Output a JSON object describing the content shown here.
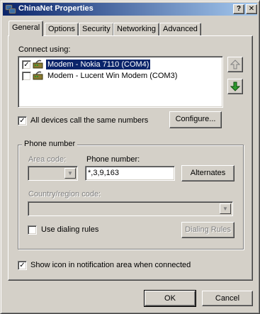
{
  "window": {
    "title": "ChinaNet Properties",
    "help_glyph": "?",
    "close_glyph": "✕"
  },
  "tabs": [
    {
      "label": "General"
    },
    {
      "label": "Options"
    },
    {
      "label": "Security"
    },
    {
      "label": "Networking"
    },
    {
      "label": "Advanced"
    }
  ],
  "general": {
    "connect_using_label": "Connect using:",
    "devices": [
      {
        "label": "Modem - Nokia 7110 (COM4)",
        "checked": true,
        "selected": true
      },
      {
        "label": "Modem - Lucent Win Modem (COM3)",
        "checked": false,
        "selected": false
      }
    ],
    "all_devices_label": "All devices call the same numbers",
    "all_devices_checked": true,
    "configure_label": "Configure...",
    "phone_group_title": "Phone number",
    "area_code_label": "Area code:",
    "phone_number_label": "Phone number:",
    "phone_number_value": "*,3,9,163",
    "alternates_label": "Alternates",
    "country_label": "Country/region code:",
    "use_dialing_rules_label": "Use dialing rules",
    "use_dialing_rules_checked": false,
    "dialing_rules_label": "Dialing Rules",
    "show_icon_label": "Show icon in notification area when connected",
    "show_icon_checked": true
  },
  "footer": {
    "ok_label": "OK",
    "cancel_label": "Cancel"
  },
  "colors": {
    "titlebar_start": "#0a246a",
    "titlebar_end": "#a6caf0",
    "face": "#d4d0c8",
    "selection": "#0a246a"
  },
  "icons": {
    "app": "network-connection-icon",
    "device": "modem-icon",
    "move_up": "arrow-up-icon",
    "move_down": "arrow-down-icon"
  }
}
